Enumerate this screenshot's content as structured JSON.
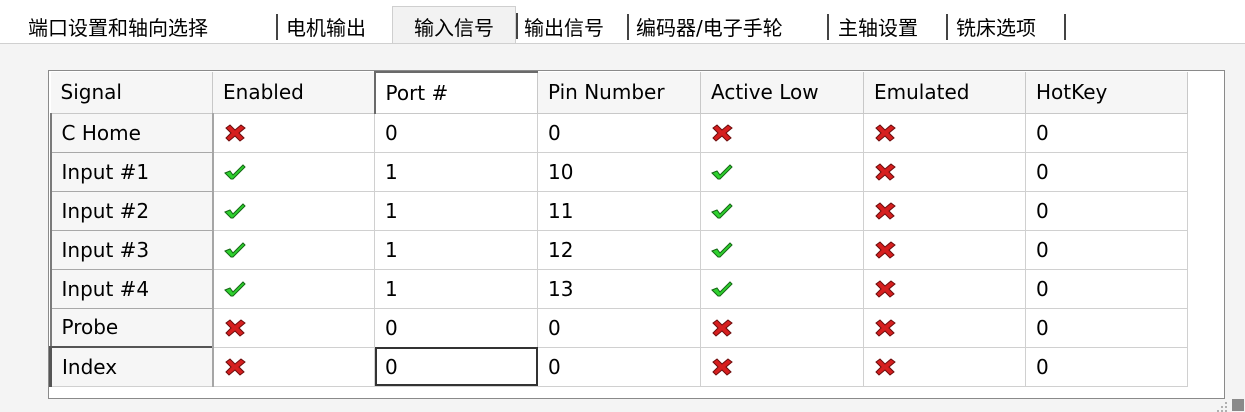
{
  "tabs": [
    {
      "label": "端口设置和轴向选择",
      "active": false
    },
    {
      "label": "电机输出",
      "active": false
    },
    {
      "label": "输入信号",
      "active": true
    },
    {
      "label": "输出信号",
      "active": false
    },
    {
      "label": "编码器/电子手轮",
      "active": false
    },
    {
      "label": "主轴设置",
      "active": false
    },
    {
      "label": "铣床选项",
      "active": false
    }
  ],
  "table": {
    "columns": [
      "Signal",
      "Enabled",
      "Port #",
      "Pin Number",
      "Active Low",
      "Emulated",
      "HotKey"
    ],
    "rows": [
      {
        "signal": "C Home",
        "enabled": false,
        "port": "0",
        "pin": "0",
        "active_low": false,
        "emulated": false,
        "hotkey": "0"
      },
      {
        "signal": "Input #1",
        "enabled": true,
        "port": "1",
        "pin": "10",
        "active_low": true,
        "emulated": false,
        "hotkey": "0"
      },
      {
        "signal": "Input #2",
        "enabled": true,
        "port": "1",
        "pin": "11",
        "active_low": true,
        "emulated": false,
        "hotkey": "0"
      },
      {
        "signal": "Input #3",
        "enabled": true,
        "port": "1",
        "pin": "12",
        "active_low": true,
        "emulated": false,
        "hotkey": "0"
      },
      {
        "signal": "Input #4",
        "enabled": true,
        "port": "1",
        "pin": "13",
        "active_low": true,
        "emulated": false,
        "hotkey": "0"
      },
      {
        "signal": "Probe",
        "enabled": false,
        "port": "0",
        "pin": "0",
        "active_low": false,
        "emulated": false,
        "hotkey": "0"
      },
      {
        "signal": "Index",
        "enabled": false,
        "port": "0",
        "pin": "0",
        "active_low": false,
        "emulated": false,
        "hotkey": "0"
      }
    ]
  },
  "icons": {
    "check": "green-check-icon",
    "cross": "red-x-icon",
    "check_color": "#2fd12f",
    "cross_color": "#d61f1f"
  }
}
